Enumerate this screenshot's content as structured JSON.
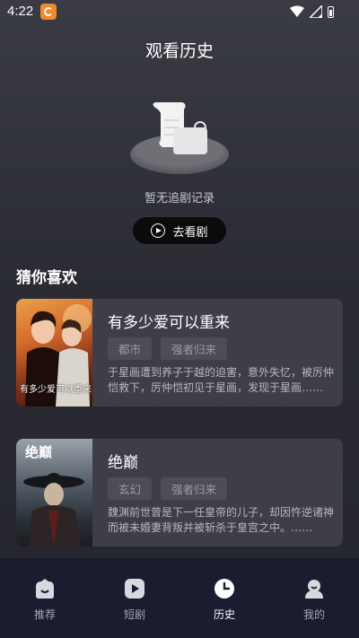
{
  "status_bar": {
    "time": "4:22"
  },
  "header": {
    "title": "观看历史"
  },
  "empty_state": {
    "message": "暂无追剧记录",
    "button_label": "去看剧"
  },
  "recommend": {
    "section_title": "猜你喜欢",
    "items": [
      {
        "title": "有多少爱可以重来",
        "tags": [
          "都市",
          "强者归来"
        ],
        "description": "于星画遭到养子于越的迫害，意外失忆，被厉仲恺救下，厉仲恺初见于星画，发现于星画……",
        "poster_text": "有多少爱可以重来"
      },
      {
        "title": "绝巅",
        "tags": [
          "玄幻",
          "强者归来"
        ],
        "description": "魏渊前世曾是下一任皇帝的儿子，却因忤逆诸神而被未婚妻背叛并被斩杀于皇宫之中。……",
        "poster_text": "绝巅"
      }
    ]
  },
  "bottom_nav": {
    "items": [
      {
        "label": "推荐",
        "icon": "home-icon"
      },
      {
        "label": "短剧",
        "icon": "play-icon"
      },
      {
        "label": "历史",
        "icon": "clock-icon",
        "active": true
      },
      {
        "label": "我的",
        "icon": "profile-icon"
      }
    ]
  },
  "colors": {
    "background": "#2a2b33",
    "card": "#3d3e48",
    "nav_bar": "#1b1c30",
    "button": "#0b0b0d"
  }
}
